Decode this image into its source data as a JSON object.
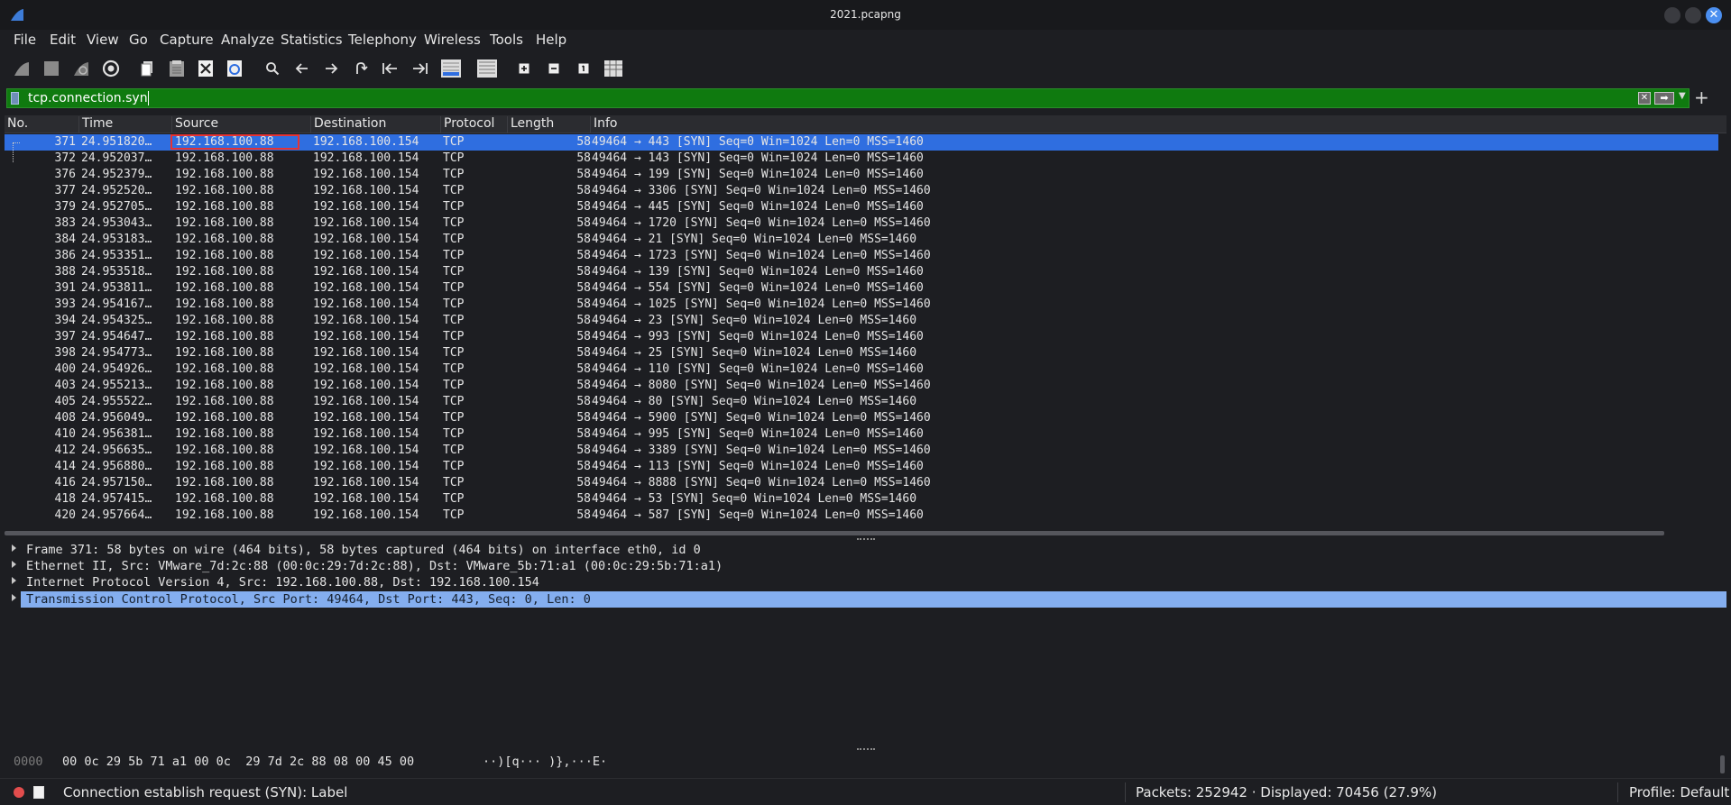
{
  "window": {
    "title": "2021.pcapng"
  },
  "menu": [
    "File",
    "Edit",
    "View",
    "Go",
    "Capture",
    "Analyze",
    "Statistics",
    "Telephony",
    "Wireless",
    "Tools",
    "Help"
  ],
  "filter": {
    "value": "tcp.connection.syn",
    "color": "#0f7a0f"
  },
  "columns": [
    "No.",
    "Time",
    "Source",
    "Destination",
    "Protocol",
    "Length",
    "Info"
  ],
  "packets": [
    {
      "no": "371",
      "time": "24.951820…",
      "src": "192.168.100.88",
      "dst": "192.168.100.154",
      "proto": "TCP",
      "len": "58",
      "info": "49464 → 443 [SYN] Seq=0 Win=1024 Len=0 MSS=1460"
    },
    {
      "no": "372",
      "time": "24.952037…",
      "src": "192.168.100.88",
      "dst": "192.168.100.154",
      "proto": "TCP",
      "len": "58",
      "info": "49464 → 143 [SYN] Seq=0 Win=1024 Len=0 MSS=1460"
    },
    {
      "no": "376",
      "time": "24.952379…",
      "src": "192.168.100.88",
      "dst": "192.168.100.154",
      "proto": "TCP",
      "len": "58",
      "info": "49464 → 199 [SYN] Seq=0 Win=1024 Len=0 MSS=1460"
    },
    {
      "no": "377",
      "time": "24.952520…",
      "src": "192.168.100.88",
      "dst": "192.168.100.154",
      "proto": "TCP",
      "len": "58",
      "info": "49464 → 3306 [SYN] Seq=0 Win=1024 Len=0 MSS=1460"
    },
    {
      "no": "379",
      "time": "24.952705…",
      "src": "192.168.100.88",
      "dst": "192.168.100.154",
      "proto": "TCP",
      "len": "58",
      "info": "49464 → 445 [SYN] Seq=0 Win=1024 Len=0 MSS=1460"
    },
    {
      "no": "383",
      "time": "24.953043…",
      "src": "192.168.100.88",
      "dst": "192.168.100.154",
      "proto": "TCP",
      "len": "58",
      "info": "49464 → 1720 [SYN] Seq=0 Win=1024 Len=0 MSS=1460"
    },
    {
      "no": "384",
      "time": "24.953183…",
      "src": "192.168.100.88",
      "dst": "192.168.100.154",
      "proto": "TCP",
      "len": "58",
      "info": "49464 → 21 [SYN] Seq=0 Win=1024 Len=0 MSS=1460"
    },
    {
      "no": "386",
      "time": "24.953351…",
      "src": "192.168.100.88",
      "dst": "192.168.100.154",
      "proto": "TCP",
      "len": "58",
      "info": "49464 → 1723 [SYN] Seq=0 Win=1024 Len=0 MSS=1460"
    },
    {
      "no": "388",
      "time": "24.953518…",
      "src": "192.168.100.88",
      "dst": "192.168.100.154",
      "proto": "TCP",
      "len": "58",
      "info": "49464 → 139 [SYN] Seq=0 Win=1024 Len=0 MSS=1460"
    },
    {
      "no": "391",
      "time": "24.953811…",
      "src": "192.168.100.88",
      "dst": "192.168.100.154",
      "proto": "TCP",
      "len": "58",
      "info": "49464 → 554 [SYN] Seq=0 Win=1024 Len=0 MSS=1460"
    },
    {
      "no": "393",
      "time": "24.954167…",
      "src": "192.168.100.88",
      "dst": "192.168.100.154",
      "proto": "TCP",
      "len": "58",
      "info": "49464 → 1025 [SYN] Seq=0 Win=1024 Len=0 MSS=1460"
    },
    {
      "no": "394",
      "time": "24.954325…",
      "src": "192.168.100.88",
      "dst": "192.168.100.154",
      "proto": "TCP",
      "len": "58",
      "info": "49464 → 23 [SYN] Seq=0 Win=1024 Len=0 MSS=1460"
    },
    {
      "no": "397",
      "time": "24.954647…",
      "src": "192.168.100.88",
      "dst": "192.168.100.154",
      "proto": "TCP",
      "len": "58",
      "info": "49464 → 993 [SYN] Seq=0 Win=1024 Len=0 MSS=1460"
    },
    {
      "no": "398",
      "time": "24.954773…",
      "src": "192.168.100.88",
      "dst": "192.168.100.154",
      "proto": "TCP",
      "len": "58",
      "info": "49464 → 25 [SYN] Seq=0 Win=1024 Len=0 MSS=1460"
    },
    {
      "no": "400",
      "time": "24.954926…",
      "src": "192.168.100.88",
      "dst": "192.168.100.154",
      "proto": "TCP",
      "len": "58",
      "info": "49464 → 110 [SYN] Seq=0 Win=1024 Len=0 MSS=1460"
    },
    {
      "no": "403",
      "time": "24.955213…",
      "src": "192.168.100.88",
      "dst": "192.168.100.154",
      "proto": "TCP",
      "len": "58",
      "info": "49464 → 8080 [SYN] Seq=0 Win=1024 Len=0 MSS=1460"
    },
    {
      "no": "405",
      "time": "24.955522…",
      "src": "192.168.100.88",
      "dst": "192.168.100.154",
      "proto": "TCP",
      "len": "58",
      "info": "49464 → 80 [SYN] Seq=0 Win=1024 Len=0 MSS=1460"
    },
    {
      "no": "408",
      "time": "24.956049…",
      "src": "192.168.100.88",
      "dst": "192.168.100.154",
      "proto": "TCP",
      "len": "58",
      "info": "49464 → 5900 [SYN] Seq=0 Win=1024 Len=0 MSS=1460"
    },
    {
      "no": "410",
      "time": "24.956381…",
      "src": "192.168.100.88",
      "dst": "192.168.100.154",
      "proto": "TCP",
      "len": "58",
      "info": "49464 → 995 [SYN] Seq=0 Win=1024 Len=0 MSS=1460"
    },
    {
      "no": "412",
      "time": "24.956635…",
      "src": "192.168.100.88",
      "dst": "192.168.100.154",
      "proto": "TCP",
      "len": "58",
      "info": "49464 → 3389 [SYN] Seq=0 Win=1024 Len=0 MSS=1460"
    },
    {
      "no": "414",
      "time": "24.956880…",
      "src": "192.168.100.88",
      "dst": "192.168.100.154",
      "proto": "TCP",
      "len": "58",
      "info": "49464 → 113 [SYN] Seq=0 Win=1024 Len=0 MSS=1460"
    },
    {
      "no": "416",
      "time": "24.957150…",
      "src": "192.168.100.88",
      "dst": "192.168.100.154",
      "proto": "TCP",
      "len": "58",
      "info": "49464 → 8888 [SYN] Seq=0 Win=1024 Len=0 MSS=1460"
    },
    {
      "no": "418",
      "time": "24.957415…",
      "src": "192.168.100.88",
      "dst": "192.168.100.154",
      "proto": "TCP",
      "len": "58",
      "info": "49464 → 53 [SYN] Seq=0 Win=1024 Len=0 MSS=1460"
    },
    {
      "no": "420",
      "time": "24.957664…",
      "src": "192.168.100.88",
      "dst": "192.168.100.154",
      "proto": "TCP",
      "len": "58",
      "info": "49464 → 587 [SYN] Seq=0 Win=1024 Len=0 MSS=1460"
    }
  ],
  "details": [
    "Frame 371: 58 bytes on wire (464 bits), 58 bytes captured (464 bits) on interface eth0, id 0",
    "Ethernet II, Src: VMware_7d:2c:88 (00:0c:29:7d:2c:88), Dst: VMware_5b:71:a1 (00:0c:29:5b:71:a1)",
    "Internet Protocol Version 4, Src: 192.168.100.88, Dst: 192.168.100.154",
    "Transmission Control Protocol, Src Port: 49464, Dst Port: 443, Seq: 0, Len: 0"
  ],
  "bytes": {
    "offset": "0000",
    "hex": "00 0c 29 5b 71 a1 00 0c  29 7d 2c 88 08 00 45 00",
    "ascii": "··)[q··· )},···E·"
  },
  "status": {
    "message": "Connection establish request (SYN): Label",
    "packets": "Packets: 252942 · Displayed: 70456 (27.9%)",
    "profile": "Profile: Default"
  },
  "icons": [
    "shark-fin-icon",
    "stop-icon",
    "restart-icon",
    "options-icon",
    "open-icon",
    "save-icon",
    "close-file-icon",
    "reload-icon",
    "search-icon",
    "back-icon",
    "forward-icon",
    "goto-icon",
    "first-icon",
    "last-icon",
    "autoscroll-icon",
    "colorize-icon",
    "zoom-in-icon",
    "zoom-out-icon",
    "normal-size-icon",
    "resize-columns-icon"
  ]
}
